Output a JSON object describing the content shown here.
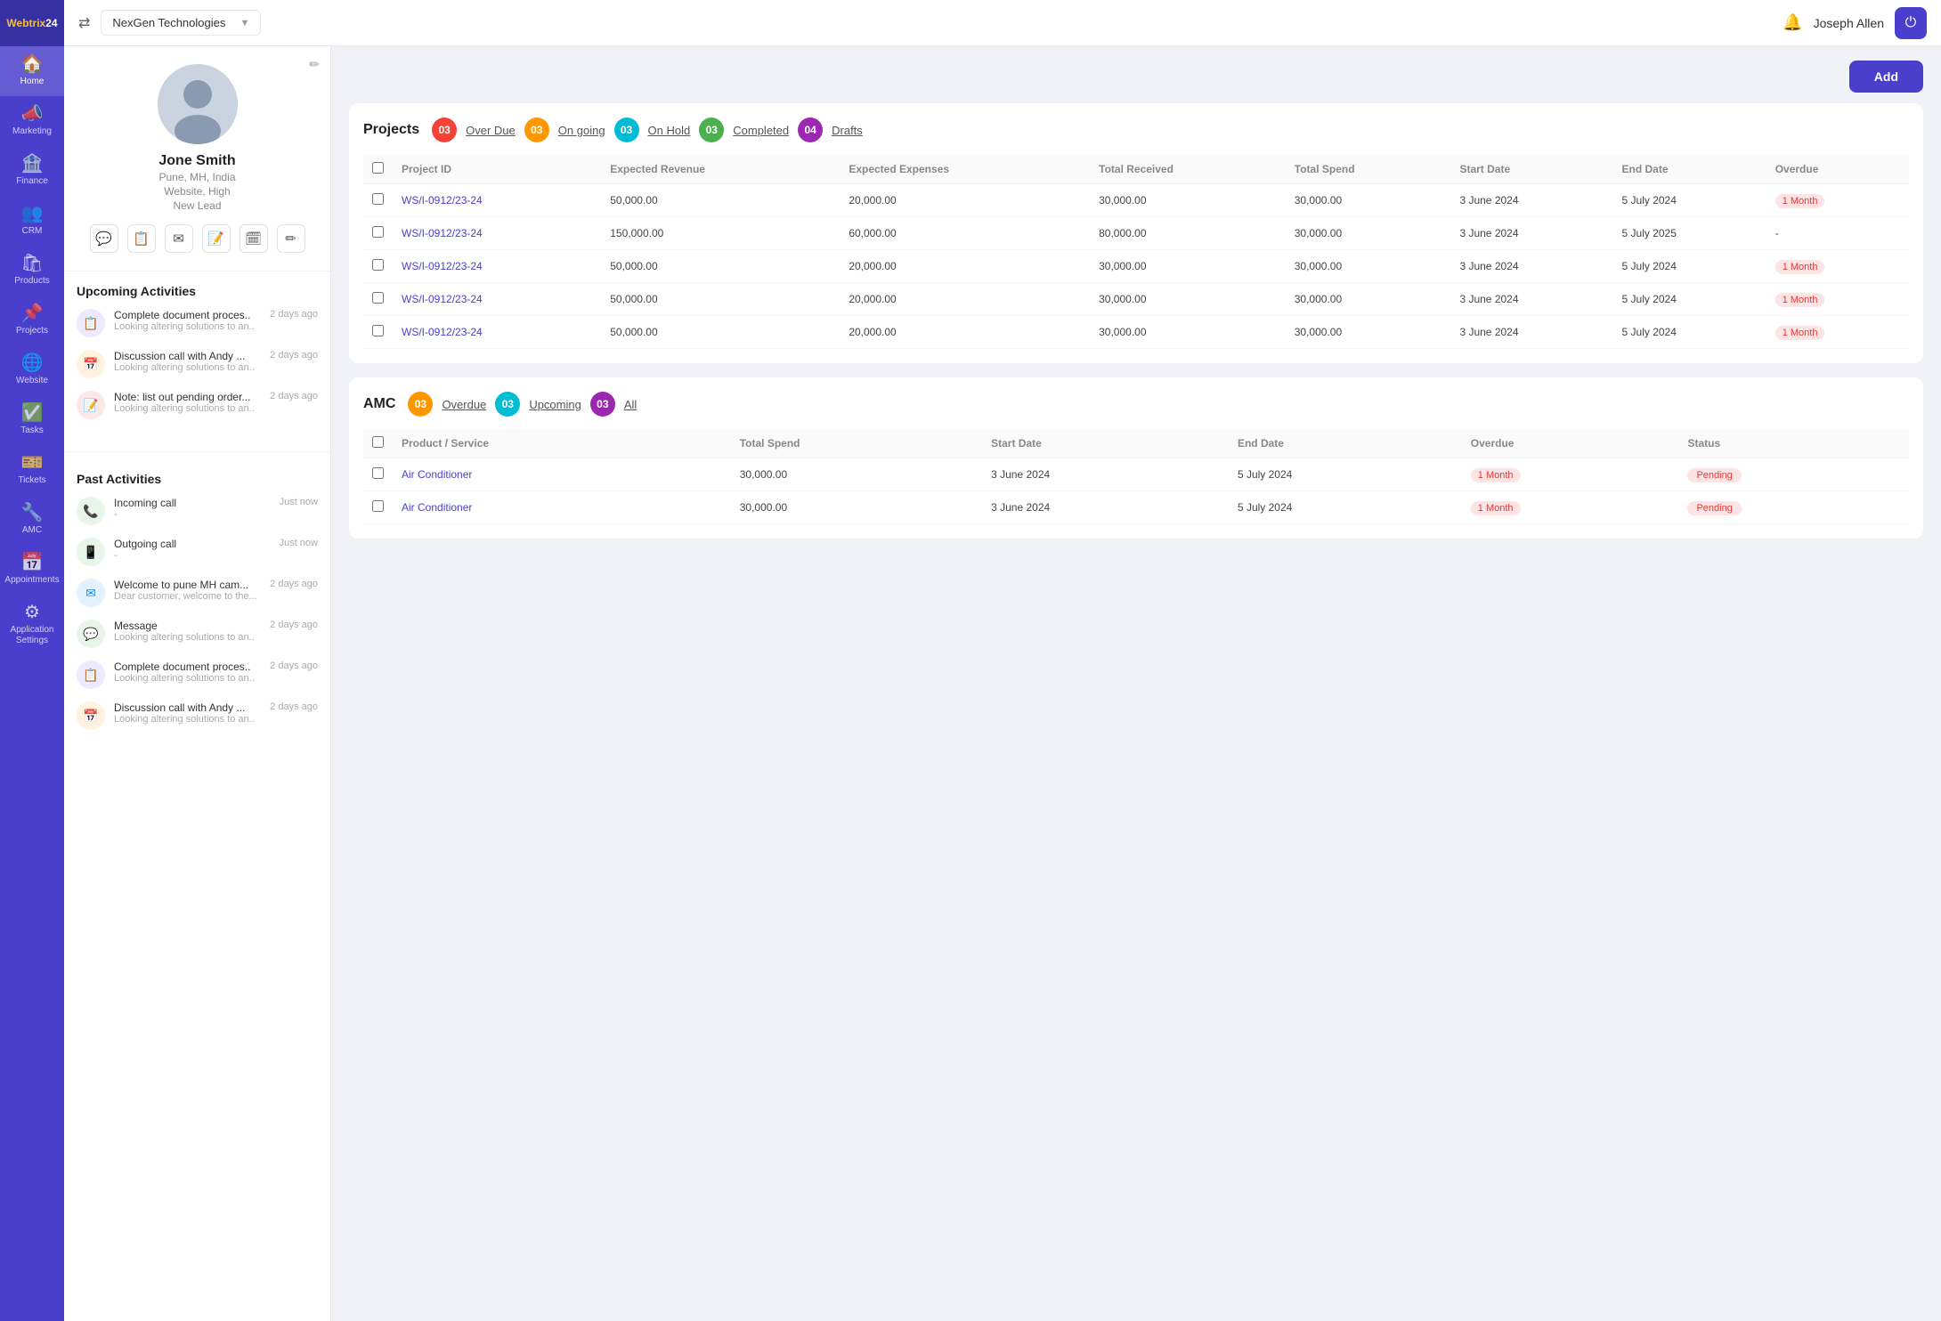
{
  "app": {
    "logo": "Webtrix24",
    "company": "NexGen Technologies",
    "user": "Joseph Allen"
  },
  "sidebar": {
    "items": [
      {
        "id": "home",
        "icon": "🏠",
        "label": "Home"
      },
      {
        "id": "marketing",
        "icon": "📣",
        "label": "Marketing"
      },
      {
        "id": "finance",
        "icon": "🏦",
        "label": "Finance"
      },
      {
        "id": "crm",
        "icon": "👥",
        "label": "CRM"
      },
      {
        "id": "products",
        "icon": "🛍",
        "label": "Products"
      },
      {
        "id": "projects",
        "icon": "📌",
        "label": "Projects"
      },
      {
        "id": "website",
        "icon": "🌐",
        "label": "Website"
      },
      {
        "id": "tasks",
        "icon": "✅",
        "label": "Tasks"
      },
      {
        "id": "tickets",
        "icon": "🎫",
        "label": "Tickets"
      },
      {
        "id": "amc",
        "icon": "🔧",
        "label": "AMC"
      },
      {
        "id": "appointments",
        "icon": "📅",
        "label": "Appointments"
      },
      {
        "id": "appsettings",
        "icon": "⚙",
        "label": "Application Settings"
      }
    ]
  },
  "profile": {
    "name": "Jone Smith",
    "location": "Pune, MH, India",
    "website": "Website, High",
    "tag": "New Lead",
    "actions": [
      "💬",
      "📋",
      "✉",
      "📝",
      "🗓",
      "✏"
    ]
  },
  "upcoming_activities": {
    "title": "Upcoming Activities",
    "items": [
      {
        "icon": "📋",
        "type": "purple",
        "title": "Complete document proces..",
        "time": "2 days ago",
        "desc": "Looking  altering solutions to an.."
      },
      {
        "icon": "📅",
        "type": "orange",
        "title": "Discussion call with Andy ...",
        "time": "2 days ago",
        "desc": "Looking  altering solutions to an.."
      },
      {
        "icon": "📝",
        "type": "peach",
        "title": "Note: list out pending order...",
        "time": "2 days ago",
        "desc": "Looking  altering solutions to an.."
      }
    ]
  },
  "past_activities": {
    "title": "Past Activities",
    "items": [
      {
        "icon": "📞",
        "type": "green",
        "title": "Incoming call",
        "time": "Just now",
        "desc": "-"
      },
      {
        "icon": "📱",
        "type": "green",
        "title": "Outgoing call",
        "time": "Just now",
        "desc": "-"
      },
      {
        "icon": "✉",
        "type": "blue",
        "title": "Welcome to pune MH cam...",
        "time": "2 days ago",
        "desc": "Dear customer, welcome to the..."
      },
      {
        "icon": "💬",
        "type": "green",
        "title": "Message",
        "time": "2 days ago",
        "desc": "Looking  altering solutions to an.."
      },
      {
        "icon": "📋",
        "type": "purple",
        "title": "Complete document proces..",
        "time": "2 days ago",
        "desc": "Looking  altering solutions to an.."
      },
      {
        "icon": "📅",
        "type": "orange",
        "title": "Discussion call with Andy ...",
        "time": "2 days ago",
        "desc": "Looking  altering solutions to an.."
      }
    ]
  },
  "add_button": "Add",
  "projects": {
    "title": "Projects",
    "tabs": [
      {
        "id": "overdue",
        "label": "Over Due",
        "count": "03",
        "badge_type": "red"
      },
      {
        "id": "ongoing",
        "label": "On going",
        "count": "03",
        "badge_type": "orange"
      },
      {
        "id": "onhold",
        "label": "On Hold",
        "count": "03",
        "badge_type": "cyan"
      },
      {
        "id": "completed",
        "label": "Completed",
        "count": "03",
        "badge_type": "green"
      },
      {
        "id": "drafts",
        "label": "Drafts",
        "count": "04",
        "badge_type": "purple"
      }
    ],
    "columns": [
      "Project ID",
      "Expected Revenue",
      "Expected Expenses",
      "Total Received",
      "Total Spend",
      "Start Date",
      "End Date",
      "Overdue"
    ],
    "rows": [
      {
        "id": "WS/I-0912/23-24",
        "exp_rev": "50,000.00",
        "exp_exp": "20,000.00",
        "tot_recv": "30,000.00",
        "tot_spend": "30,000.00",
        "start": "3 June 2024",
        "end": "5 July 2024",
        "overdue": "1 Month"
      },
      {
        "id": "WS/I-0912/23-24",
        "exp_rev": "150,000.00",
        "exp_exp": "60,000.00",
        "tot_recv": "80,000.00",
        "tot_spend": "30,000.00",
        "start": "3 June 2024",
        "end": "5 July 2025",
        "overdue": "-"
      },
      {
        "id": "WS/I-0912/23-24",
        "exp_rev": "50,000.00",
        "exp_exp": "20,000.00",
        "tot_recv": "30,000.00",
        "tot_spend": "30,000.00",
        "start": "3 June 2024",
        "end": "5 July 2024",
        "overdue": "1 Month"
      },
      {
        "id": "WS/I-0912/23-24",
        "exp_rev": "50,000.00",
        "exp_exp": "20,000.00",
        "tot_recv": "30,000.00",
        "tot_spend": "30,000.00",
        "start": "3 June 2024",
        "end": "5 July 2024",
        "overdue": "1 Month"
      },
      {
        "id": "WS/I-0912/23-24",
        "exp_rev": "50,000.00",
        "exp_exp": "20,000.00",
        "tot_recv": "30,000.00",
        "tot_spend": "30,000.00",
        "start": "3 June 2024",
        "end": "5 July 2024",
        "overdue": "1 Month"
      }
    ]
  },
  "amc": {
    "title": "AMC",
    "tabs": [
      {
        "id": "overdue",
        "label": "Overdue",
        "count": "03",
        "badge_type": "orange"
      },
      {
        "id": "upcoming",
        "label": "Upcoming",
        "count": "03",
        "badge_type": "cyan"
      },
      {
        "id": "all",
        "label": "All",
        "count": "03",
        "badge_type": "purple"
      }
    ],
    "columns": [
      "Product / Service",
      "Total Spend",
      "Start Date",
      "End Date",
      "Overdue",
      "Status"
    ],
    "rows": [
      {
        "product": "Air Conditioner",
        "total_spend": "30,000.00",
        "start": "3 June 2024",
        "end": "5 July 2024",
        "overdue": "1 Month",
        "status": "Pending"
      },
      {
        "product": "Air Conditioner",
        "total_spend": "30,000.00",
        "start": "3 June 2024",
        "end": "5 July 2024",
        "overdue": "1 Month",
        "status": "Pending"
      }
    ]
  }
}
